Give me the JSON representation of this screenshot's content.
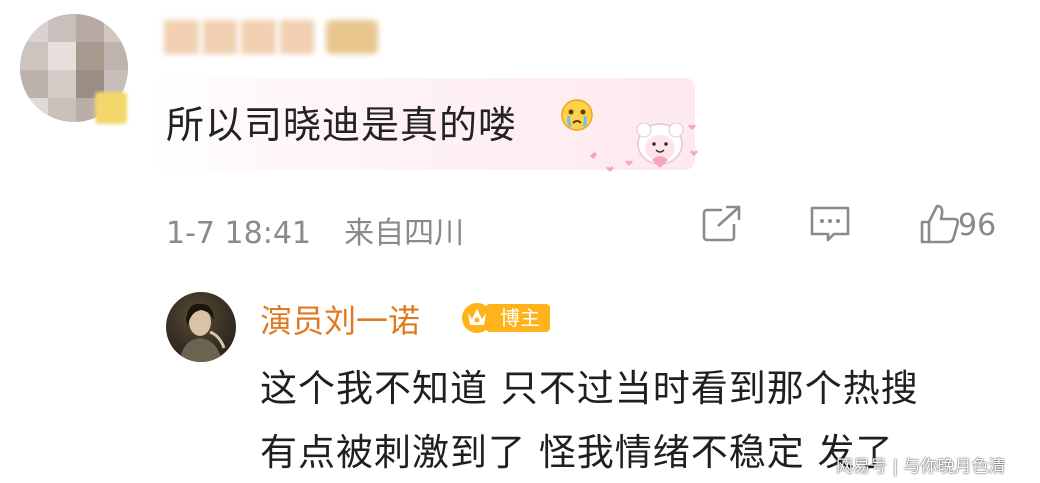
{
  "comment": {
    "text": "所以司晓迪是真的喽",
    "time": "1-7 18:41",
    "source": "来自四川",
    "like_count": "96",
    "icons": [
      "share-icon",
      "reply-icon",
      "like-icon"
    ]
  },
  "reply": {
    "author": "演员刘一诺",
    "badge": "博主",
    "line1": "这个我不知道 只不过当时看到那个热搜",
    "line2": "有点被刺激到了 怪我情绪不稳定 发了"
  },
  "watermark": {
    "text": "网易号 | 与你晚月色清"
  },
  "colors": {
    "author_name": "#e07a21",
    "badge_bg": "#ffb21a",
    "meta_gray": "#8a8a8a",
    "bubble_pink": "#fde9ee"
  }
}
